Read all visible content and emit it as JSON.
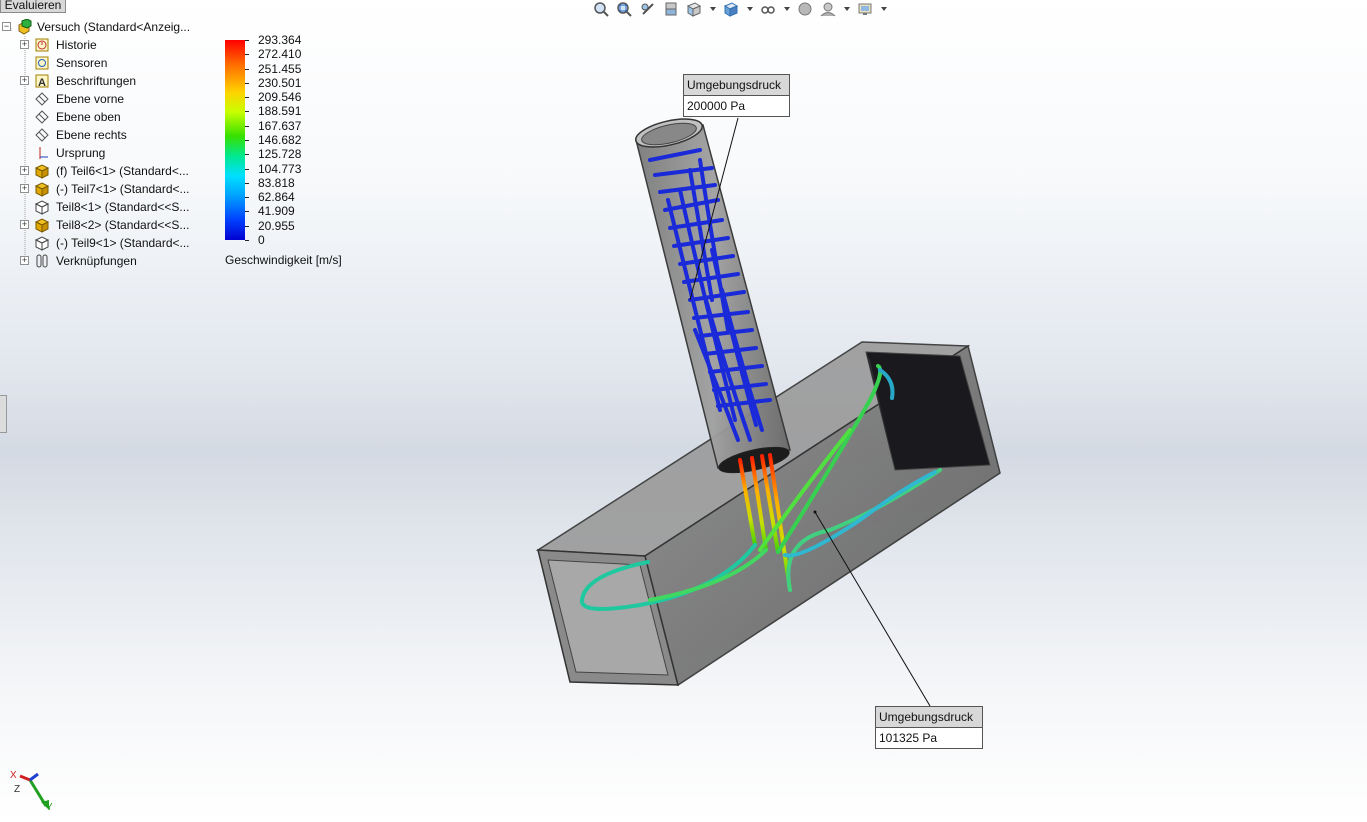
{
  "evaluate_tab": "Evaluieren",
  "tree": {
    "root": "Versuch  (Standard<Anzeig...",
    "items": [
      {
        "label": "Historie",
        "icon": "history-icon",
        "expandable": true
      },
      {
        "label": "Sensoren",
        "icon": "sensor-icon",
        "expandable": false
      },
      {
        "label": "Beschriftungen",
        "icon": "annotations-icon",
        "expandable": true
      },
      {
        "label": "Ebene vorne",
        "icon": "plane-icon",
        "expandable": false
      },
      {
        "label": "Ebene oben",
        "icon": "plane-icon",
        "expandable": false
      },
      {
        "label": "Ebene rechts",
        "icon": "plane-icon",
        "expandable": false
      },
      {
        "label": "Ursprung",
        "icon": "origin-icon",
        "expandable": false
      },
      {
        "label": "(f) Teil6<1> (Standard<...",
        "icon": "part-icon",
        "expandable": true
      },
      {
        "label": "(-) Teil7<1> (Standard<...",
        "icon": "part-icon",
        "expandable": true
      },
      {
        "label": "Teil8<1> (Standard<<S...",
        "icon": "part-outline-icon",
        "expandable": false
      },
      {
        "label": "Teil8<2> (Standard<<S...",
        "icon": "part-icon",
        "expandable": true
      },
      {
        "label": "(-) Teil9<1> (Standard<...",
        "icon": "part-outline-icon",
        "expandable": false
      },
      {
        "label": "Verknüpfungen",
        "icon": "mates-icon",
        "expandable": true
      }
    ]
  },
  "legend": {
    "values": [
      "293.364",
      "272.410",
      "251.455",
      "230.501",
      "209.546",
      "188.591",
      "167.637",
      "146.682",
      "125.728",
      "104.773",
      "83.818",
      "62.864",
      "41.909",
      "20.955",
      "0"
    ],
    "title": "Geschwindigkeit [m/s]"
  },
  "callouts": [
    {
      "title": "Umgebungsdruck",
      "value": "200000 Pa"
    },
    {
      "title": "Umgebungsdruck",
      "value": "101325 Pa"
    }
  ],
  "toolbar": [
    "zoom-to-fit-icon",
    "zoom-to-area-icon",
    "previous-view-icon",
    "section-view-icon",
    "view-orientation-icon",
    "display-style-icon",
    "hide-show-items-icon",
    "edit-appearance-icon",
    "apply-scene-icon",
    "view-settings-icon"
  ],
  "triad": {
    "x": "X",
    "y": "Y",
    "z": "Z"
  }
}
